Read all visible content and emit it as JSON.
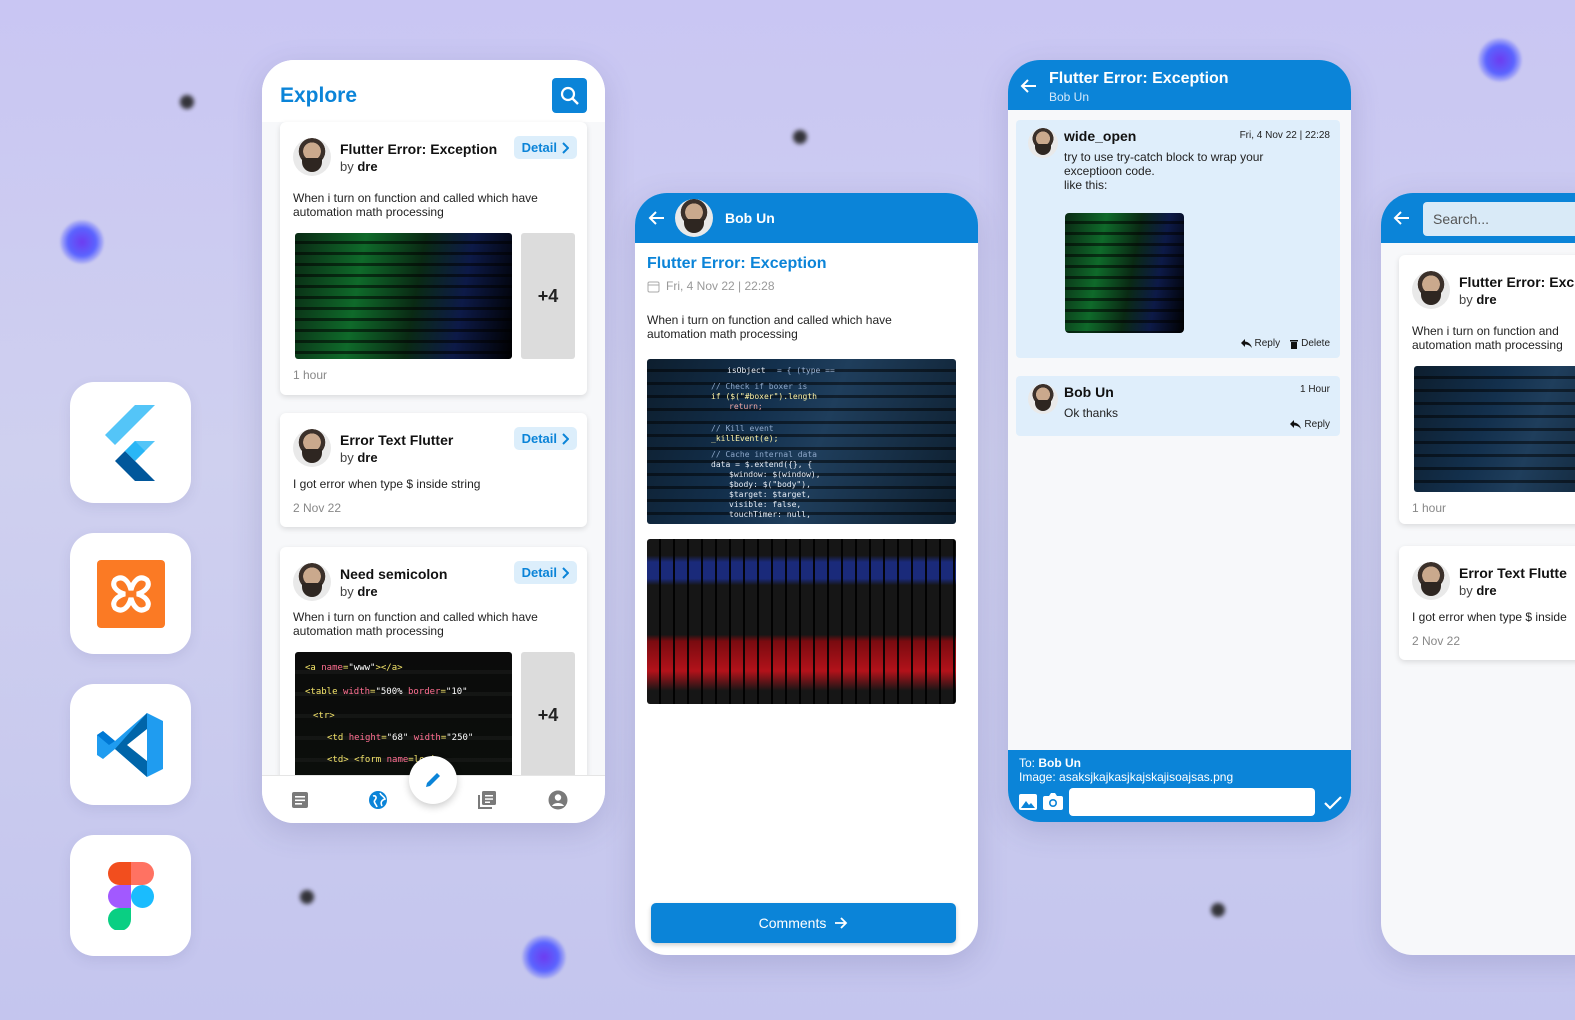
{
  "explore": {
    "title": "Explore",
    "posts": [
      {
        "title": "Flutter Error: Exception",
        "by_prefix": "by",
        "author": "dre",
        "detail": "Detail",
        "desc": "When i turn on function and called which have automation math processing",
        "more": "+4",
        "time": "1 hour"
      },
      {
        "title": "Error Text Flutter",
        "by_prefix": "by",
        "author": "dre",
        "detail": "Detail",
        "desc": "I got error when type $ inside string",
        "time": "2 Nov 22"
      },
      {
        "title": "Need semicolon",
        "by_prefix": "by",
        "author": "dre",
        "detail": "Detail",
        "desc": "When i turn on function and called which have automation math processing",
        "more": "+4"
      }
    ]
  },
  "detail": {
    "user": "Bob Un",
    "title": "Flutter Error: Exception",
    "date": "Fri, 4 Nov 22 | 22:28",
    "desc": "When i turn on function and called which have automation math processing",
    "comments_btn": "Comments"
  },
  "thread": {
    "title": "Flutter Error: Exception",
    "subtitle": "Bob Un",
    "comments": [
      {
        "user": "wide_open",
        "when": "Fri, 4 Nov 22 | 22:28",
        "text1": "try to use try-catch block to wrap your",
        "text2": "exceptioon code.",
        "text3": "like this:",
        "reply": "Reply",
        "delete": "Delete"
      },
      {
        "user": "Bob Un",
        "when": "1 Hour",
        "text1": "Ok thanks",
        "reply": "Reply"
      }
    ],
    "compose": {
      "to_label": "To:",
      "to_value": "Bob Un",
      "image_label": "Image:",
      "image_value": "asaksjkajkasjkajskajisoajsas.png"
    }
  },
  "search": {
    "placeholder": "Search...",
    "posts": [
      {
        "title": "Flutter Error: Exc",
        "by_prefix": "by",
        "author": "dre",
        "desc": "When i turn on function and",
        "desc2": "automation math processing",
        "time": "1 hour"
      },
      {
        "title": "Error Text Flutte",
        "by_prefix": "by",
        "author": "dre",
        "desc": "I got error when type $ inside",
        "time": "2 Nov 22"
      }
    ]
  },
  "colors": {
    "accent": "#0b84d8",
    "chip": "#dceefb"
  }
}
